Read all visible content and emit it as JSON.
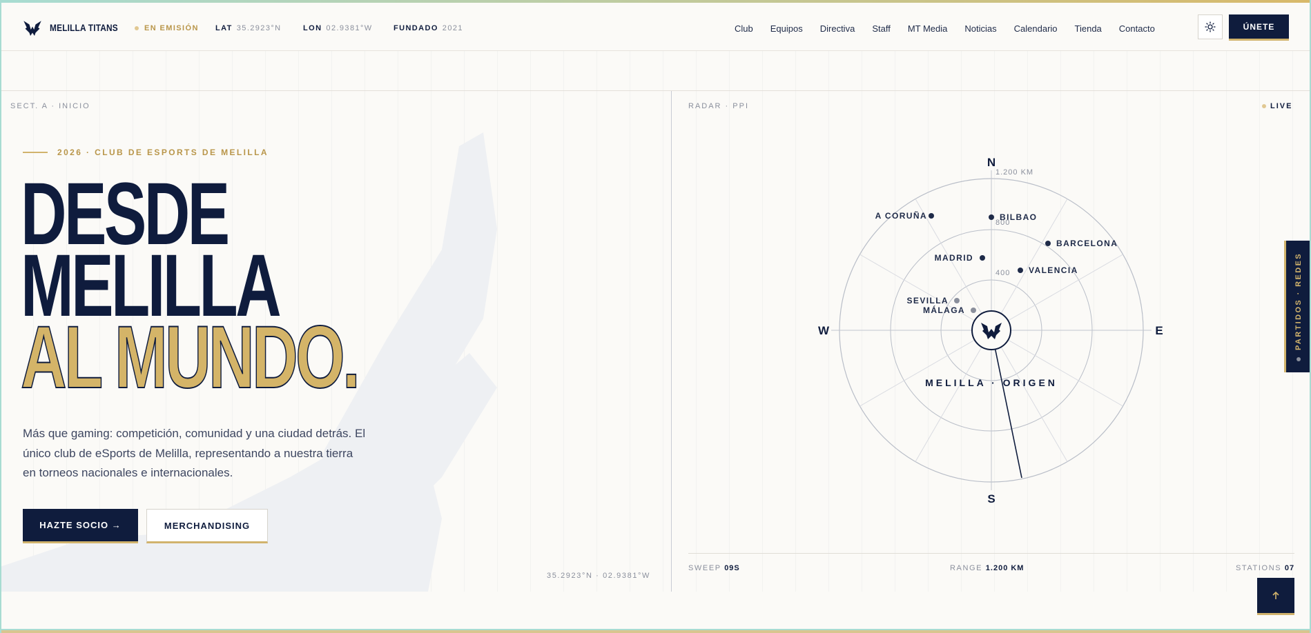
{
  "brand": {
    "name": "MELILLA TITANS"
  },
  "status": {
    "on_air": "EN EMISIÓN"
  },
  "meta": [
    {
      "key": "LAT",
      "value": "35.2923°N"
    },
    {
      "key": "LON",
      "value": "02.9381°W"
    },
    {
      "key": "FUNDADO",
      "value": "2021"
    }
  ],
  "nav": {
    "items": [
      "Club",
      "Equipos",
      "Directiva",
      "Staff",
      "MT Media",
      "Noticias",
      "Calendario",
      "Tienda",
      "Contacto"
    ]
  },
  "header": {
    "join_label": "ÚNETE",
    "theme_icon": "sun-icon"
  },
  "hero": {
    "section_label": "SECT. A · INICIO",
    "eyebrow": "2026 · CLUB DE ESPORTS DE MELILLA",
    "title_line1": "DESDE",
    "title_line2": "MELILLA",
    "title_line3": "AL MUNDO.",
    "lead": "Más que gaming: competición, comunidad y una ciudad detrás. El único club de eSports de Melilla, representando a nuestra tierra en torneos nacionales e internacionales.",
    "cta_primary": "HAZTE SOCIO →",
    "cta_secondary": "MERCHANDISING",
    "coords": "35.2923°N · 02.9381°W"
  },
  "radar": {
    "label": "RADAR · PPI",
    "live": "LIVE",
    "compass": {
      "n": "N",
      "s": "S",
      "e": "E",
      "w": "W"
    },
    "rings": [
      "1.200 KM",
      "800",
      "400"
    ],
    "origin": "MELILLA · ORIGEN",
    "cities": [
      {
        "name": "A CORUÑA",
        "muted": false
      },
      {
        "name": "BILBAO",
        "muted": false
      },
      {
        "name": "BARCELONA",
        "muted": false
      },
      {
        "name": "MADRID",
        "muted": false
      },
      {
        "name": "VALENCIA",
        "muted": false
      },
      {
        "name": "SEVILLA",
        "muted": true
      },
      {
        "name": "MÁLAGA",
        "muted": true
      }
    ],
    "stats": {
      "sweep_label": "SWEEP",
      "sweep_value": "09S",
      "range_label": "RANGE",
      "range_value": "1.200 KM",
      "stations_label": "STATIONS",
      "stations_value": "07"
    }
  },
  "side_tab": {
    "label": "PARTIDOS · REDES"
  },
  "colors": {
    "navy": "#0f1c3d",
    "gold": "#d4b468",
    "accent": "#b9964a"
  }
}
